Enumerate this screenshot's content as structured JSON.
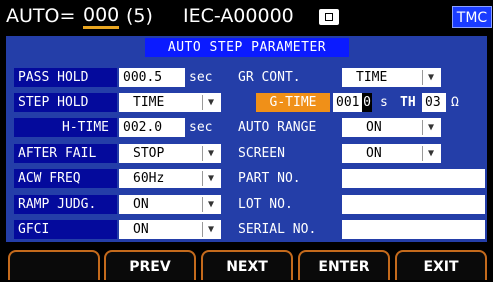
{
  "status": {
    "auto_label": "AUTO=",
    "auto_value": "000",
    "auto_count": "(5)",
    "iec_mode": "IEC-A00000",
    "mode_badge": "TMC"
  },
  "panel": {
    "title": "AUTO STEP PARAMETER",
    "left": {
      "pass_hold": {
        "label": "PASS HOLD",
        "value": "000.5",
        "unit": "sec"
      },
      "step_hold": {
        "label": "STEP HOLD",
        "value": "TIME"
      },
      "h_time": {
        "label": "H-TIME",
        "value": "002.0",
        "unit": "sec"
      },
      "after_fail": {
        "label": "AFTER FAIL",
        "value": "STOP"
      },
      "acw_freq": {
        "label": "ACW FREQ",
        "value": "60Hz"
      },
      "ramp_judg": {
        "label": "RAMP JUDG.",
        "value": "ON"
      },
      "gfci": {
        "label": "GFCI",
        "value": "ON"
      }
    },
    "right": {
      "gr_cont": {
        "label": "GR CONT.",
        "value": "TIME"
      },
      "g_time": {
        "label": "G-TIME",
        "value_main": "001.",
        "value_cursor": "0",
        "unit": "s"
      },
      "th": {
        "label": "TH",
        "value": "03",
        "unit": "Ω"
      },
      "auto_range": {
        "label": "AUTO RANGE",
        "value": "ON"
      },
      "screen": {
        "label": "SCREEN",
        "value": "ON"
      },
      "part_no": {
        "label": "PART NO.",
        "value": ""
      },
      "lot_no": {
        "label": "LOT NO.",
        "value": ""
      },
      "serial_no": {
        "label": "SERIAL NO.",
        "value": ""
      }
    }
  },
  "softkeys": [
    "",
    "PREV",
    "NEXT",
    "ENTER",
    "EXIT"
  ],
  "colors": {
    "panel": "#243ea8",
    "label_bg": "#040a9c",
    "header": "#0b1bff",
    "accent": "#f09018"
  }
}
